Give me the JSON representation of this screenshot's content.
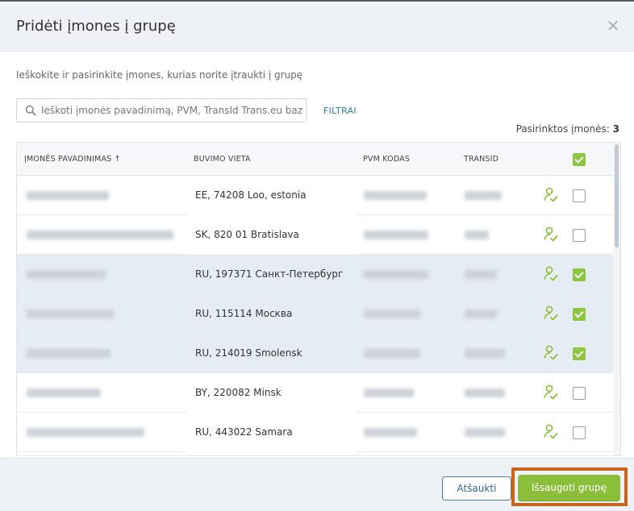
{
  "dialog": {
    "title": "Pridėti įmones į grupę",
    "subtitle": "Ieškokite ir pasirinkite įmones, kurias norite įtraukti į grupę",
    "close_icon": "close-icon"
  },
  "search": {
    "placeholder": "Ieškoti įmonės pavadinimą, PVM, TransId Trans.eu bazėj...",
    "icon": "search-icon",
    "filter_label": "FILTRAI"
  },
  "selection": {
    "label": "Pasirinktos įmonės:",
    "count": "3"
  },
  "table": {
    "headers": {
      "name": "ĮMONĖS PAVADINIMAS ↑",
      "location": "BUVIMO VIETA",
      "vat": "PVM KODAS",
      "transid": "TRANSID"
    },
    "header_checkbox": true,
    "rows": [
      {
        "location": "EE, 74208 Loo, estonia",
        "selected": false
      },
      {
        "location": "SK, 820 01 Bratislava",
        "selected": false
      },
      {
        "location": "RU, 197371 Санкт-Петербург",
        "selected": true
      },
      {
        "location": "RU, 115114 Москва",
        "selected": true
      },
      {
        "location": "RU, 214019 Smolensk",
        "selected": true
      },
      {
        "location": "BY, 220082 Minsk",
        "selected": false
      },
      {
        "location": "RU, 443022 Samara",
        "selected": false
      }
    ]
  },
  "footer": {
    "cancel_label": "Atšaukti",
    "save_label": "Išsaugoti grupę"
  },
  "colors": {
    "accent_green": "#8bbe3a",
    "link_blue": "#2e7fa8",
    "highlight_orange": "#c6651c",
    "selected_row": "#e6ecf3"
  }
}
